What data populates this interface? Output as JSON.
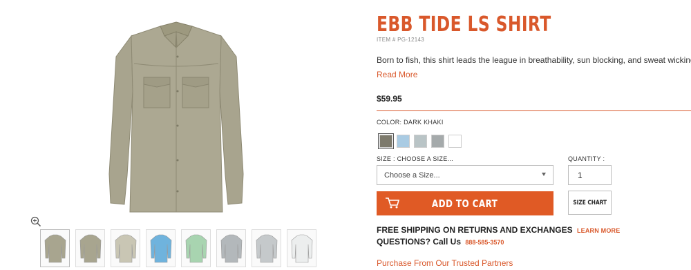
{
  "product": {
    "title": "EBB TIDE LS SHIRT",
    "item_number": "ITEM # PG-12143",
    "description": "Born to fish, this shirt leads the league in breathability, sun blocking, and sweat wicking ability.",
    "read_more": "Read More",
    "price": "$59.95"
  },
  "color": {
    "label": "COLOR:",
    "selected_name": "DARK KHAKI",
    "swatches": [
      {
        "name": "dark-khaki",
        "hex": "#7d7a6c"
      },
      {
        "name": "light-blue",
        "hex": "#a9cbe3"
      },
      {
        "name": "light-gray-blue",
        "hex": "#b9c4c6"
      },
      {
        "name": "gray",
        "hex": "#a5aaab"
      },
      {
        "name": "white",
        "hex": "#ffffff"
      }
    ]
  },
  "size": {
    "label": "SIZE : CHOOSE A SIZE...",
    "placeholder": "Choose a Size..."
  },
  "quantity": {
    "label": "QUANTITY :",
    "value": "1"
  },
  "buttons": {
    "add_to_cart": "ADD TO CART",
    "size_chart": "SIZE CHART"
  },
  "shipping": {
    "text": "FREE SHIPPING ON RETURNS AND EXCHANGES",
    "learn_more": "LEARN MORE",
    "questions": "QUESTIONS? Call Us",
    "phone": "888-585-3570",
    "partners": "Purchase From Our Trusted Partners"
  },
  "thumbnails": [
    {
      "name": "khaki-front",
      "color": "#a8a58f"
    },
    {
      "name": "khaki-back",
      "color": "#a8a58f"
    },
    {
      "name": "khaki-detail",
      "color": "#c9c6b4"
    },
    {
      "name": "blue",
      "color": "#6fb3dd"
    },
    {
      "name": "green",
      "color": "#a8d4b0"
    },
    {
      "name": "gray",
      "color": "#b3b8bb"
    },
    {
      "name": "light-gray",
      "color": "#c5c9cb"
    },
    {
      "name": "white",
      "color": "#eceeee"
    }
  ],
  "colors": {
    "accent": "#d9582b",
    "button": "#e05a25",
    "shirt": "#a9a58f"
  }
}
